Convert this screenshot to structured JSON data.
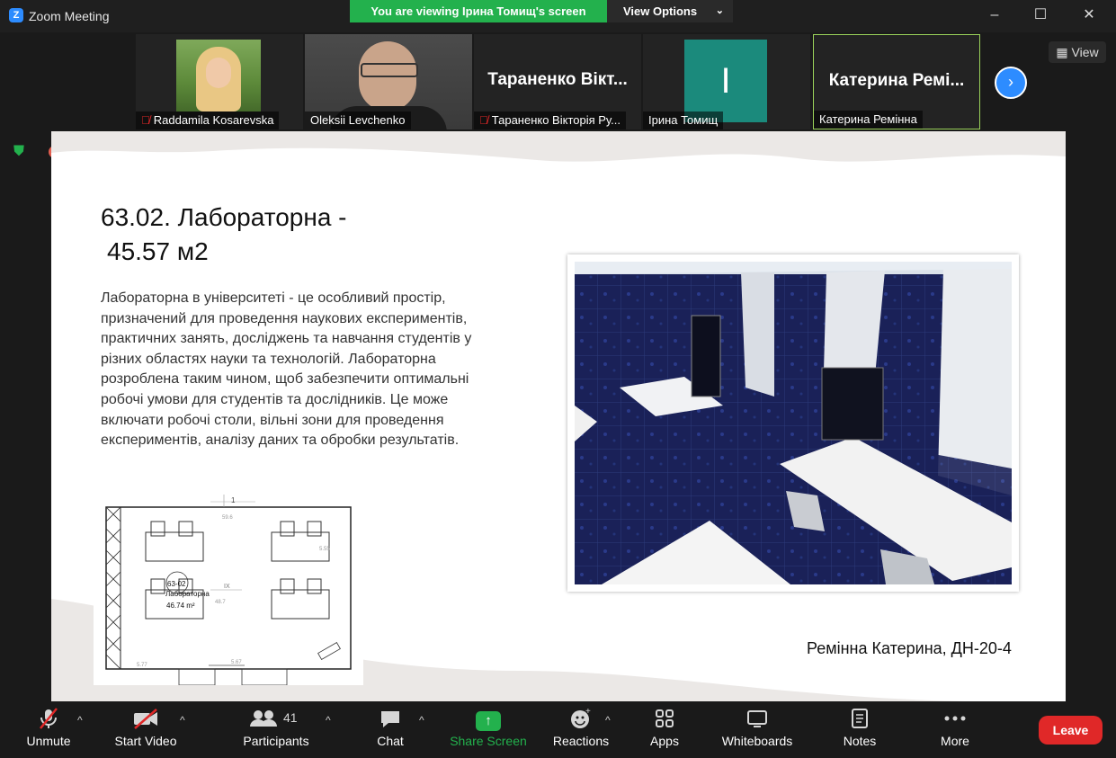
{
  "window": {
    "app_logo": "Z",
    "title": "Zoom Meeting",
    "minimize": "–",
    "maximize": "☐",
    "close": "✕"
  },
  "banner": {
    "viewing_text": "You are viewing Ірина Томищ's screen",
    "view_options": "View Options",
    "view_options_chevron": "⌄"
  },
  "participants_strip": [
    {
      "name": "Raddamila Kosarevska",
      "muted": true
    },
    {
      "name": "Oleksii Levchenko",
      "muted": false
    },
    {
      "display": "Тараненко Вікт...",
      "name": "Тараненко Вікторія Ру...",
      "muted": true
    },
    {
      "name": "Ірина Томищ",
      "muted": false,
      "avatar_letter": "I",
      "avatar_color": "#1b8a7c"
    },
    {
      "display": "Катерина Ремі...",
      "name": "Катерина Ремінна",
      "muted": false,
      "active_speaker": true
    }
  ],
  "strip_controls": {
    "next_icon": "›",
    "view_label": "View",
    "view_icon": "▦"
  },
  "icons": {
    "security": "shield-icon",
    "record": "record-icon",
    "muted_mic": "mic-off-icon"
  },
  "slide": {
    "title_line1": "63.02. Лабораторна  -",
    "title_line2": "45.57 м2",
    "body": "Лабораторна в університеті - це особливий простір, призначений для проведення наукових експериментів, практичних занять, досліджень та навчання студентів у різних областях науки та технологій. Лабораторна розроблена таким чином, щоб забезпечити оптимальні робочі умови для студентів та дослідників. Це може включати робочі столи, вільні зони для проведення експериментів, аналізу даних та обробки результатів.",
    "author": "Ремінна Катерина, ДН-20-4",
    "floorplan": {
      "room_code": "63-02",
      "room_name": "Лабораторна",
      "area": "46.74 m²",
      "dim_top": "59.6",
      "dim_right": "5.55",
      "dim_mid": "48.7",
      "mark_ix": "IX",
      "dim_bottom_left": "5.77",
      "dim_bottom": "5.67",
      "grid_num": "1"
    }
  },
  "toolbar": {
    "items": [
      {
        "label": "Unmute",
        "icon": "mic-off-icon"
      },
      {
        "label": "Start Video",
        "icon": "video-off-icon"
      },
      {
        "label": "Participants",
        "icon": "participants-icon",
        "count": "41"
      },
      {
        "label": "Chat",
        "icon": "chat-icon"
      },
      {
        "label": "Share Screen",
        "icon": "share-screen-icon"
      },
      {
        "label": "Reactions",
        "icon": "reactions-icon"
      },
      {
        "label": "Apps",
        "icon": "apps-icon"
      },
      {
        "label": "Whiteboards",
        "icon": "whiteboard-icon"
      },
      {
        "label": "Notes",
        "icon": "notes-icon"
      },
      {
        "label": "More",
        "icon": "more-icon"
      }
    ],
    "caret": "^",
    "leave": "Leave",
    "share_accent": "#23b14d",
    "leave_color": "#e02828"
  }
}
